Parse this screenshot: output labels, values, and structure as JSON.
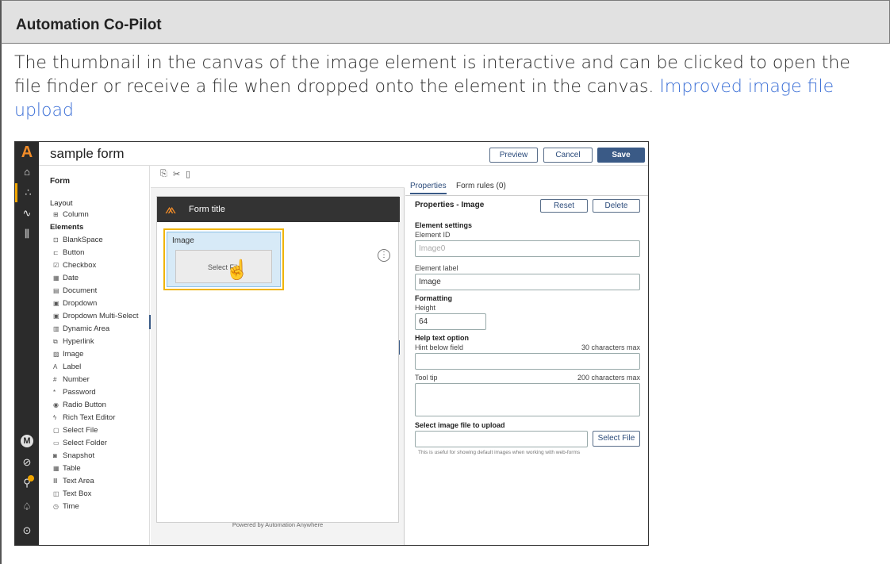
{
  "banner": {
    "title": "Automation Co-Pilot"
  },
  "description": {
    "text": "The thumbnail in the canvas of the image element is interactive and can be clicked to open the file finder or receive a file when dropped onto the element in the canvas. ",
    "link": "Improved image file upload"
  },
  "app": {
    "title": "sample form",
    "buttons": {
      "preview": "Preview",
      "cancel": "Cancel",
      "save": "Save"
    },
    "rail": {
      "logo": "A",
      "avatar": "M"
    },
    "palette": {
      "header": "Form",
      "layout_label": "Layout",
      "layout_items": [
        {
          "icon": "column-icon",
          "label": "Column"
        }
      ],
      "elements_label": "Elements",
      "elements": [
        {
          "icon": "blankspace-icon",
          "label": "BlankSpace"
        },
        {
          "icon": "button-icon",
          "label": "Button"
        },
        {
          "icon": "checkbox-icon",
          "label": "Checkbox"
        },
        {
          "icon": "date-icon",
          "label": "Date"
        },
        {
          "icon": "document-icon",
          "label": "Document"
        },
        {
          "icon": "dropdown-icon",
          "label": "Dropdown"
        },
        {
          "icon": "dropdown-multi-icon",
          "label": "Dropdown Multi-Select"
        },
        {
          "icon": "dynamic-area-icon",
          "label": "Dynamic Area"
        },
        {
          "icon": "hyperlink-icon",
          "label": "Hyperlink"
        },
        {
          "icon": "image-icon",
          "label": "Image"
        },
        {
          "icon": "label-icon",
          "label": "Label"
        },
        {
          "icon": "number-icon",
          "label": "Number"
        },
        {
          "icon": "password-icon",
          "label": "Password"
        },
        {
          "icon": "radio-icon",
          "label": "Radio Button"
        },
        {
          "icon": "rich-text-icon",
          "label": "Rich Text Editor"
        },
        {
          "icon": "select-file-icon",
          "label": "Select File"
        },
        {
          "icon": "select-folder-icon",
          "label": "Select Folder"
        },
        {
          "icon": "snapshot-icon",
          "label": "Snapshot"
        },
        {
          "icon": "table-icon",
          "label": "Table"
        },
        {
          "icon": "text-area-icon",
          "label": "Text Area"
        },
        {
          "icon": "text-box-icon",
          "label": "Text Box"
        },
        {
          "icon": "time-icon",
          "label": "Time"
        }
      ]
    },
    "canvas": {
      "form_title": "Form title",
      "image_label": "Image",
      "thumbnail_text": "Select File",
      "powered_by": "Powered by Automation Anywhere"
    },
    "properties": {
      "tabs": [
        "Properties",
        "Form rules (0)"
      ],
      "title": "Properties - Image",
      "reset": "Reset",
      "delete": "Delete",
      "element_settings": "Element settings",
      "element_id_label": "Element ID",
      "element_id_value": "Image0",
      "element_label_label": "Element label",
      "element_label_value": "Image",
      "formatting": "Formatting",
      "height_label": "Height",
      "height_value": "64",
      "help_text": "Help text option",
      "hint_label": "Hint below field",
      "hint_max": "30 characters max",
      "tooltip_label": "Tool tip",
      "tooltip_max": "200 characters max",
      "upload_label": "Select image file to upload",
      "select_file_button": "Select File",
      "upload_hint": "This is useful for showing default images when working with web-forms"
    }
  }
}
